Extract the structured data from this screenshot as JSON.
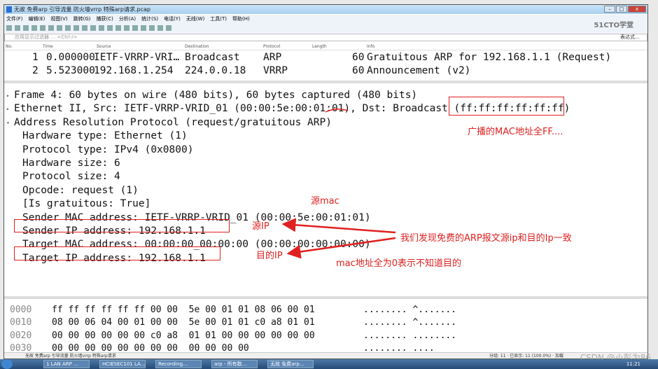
{
  "window": {
    "title": "无故 免费arp 引导流量 防火墙vrrp 特殊arp请求.pcap",
    "logo": "51CTO学堂"
  },
  "menu": [
    "文件(F)",
    "编辑(E)",
    "视图(V)",
    "跳转(G)",
    "捕获(C)",
    "分析(A)",
    "统计(S)",
    "电话(Y)",
    "无线(W)",
    "工具(T)",
    "帮助(H)"
  ],
  "filter": {
    "placeholder": "应用显示过滤器 … <Ctrl-/>",
    "expression_label": "表达式…"
  },
  "packet_list": {
    "columns": [
      "No.",
      "Time",
      "Source",
      "Destination",
      "Protocol",
      "Length",
      "Info"
    ],
    "rows": [
      {
        "no": "1",
        "time": "0.000000",
        "source": "IETF-VRRP-VRI…",
        "destination": "Broadcast",
        "protocol": "ARP",
        "length": "60",
        "info": "Gratuitous ARP for 192.168.1.1 (Request)"
      },
      {
        "no": "2",
        "time": "5.523000",
        "source": "192.168.1.254",
        "destination": "224.0.0.18",
        "protocol": "VRRP",
        "length": "60",
        "info": "Announcement (v2)"
      }
    ]
  },
  "details": [
    "Frame 4: 60 bytes on wire (480 bits), 60 bytes captured (480 bits)",
    "Ethernet II, Src: IETF-VRRP-VRID_01 (00:00:5e:00:01:01), Dst: Broadcast (ff:ff:ff:ff:ff:ff)",
    "Address Resolution Protocol (request/gratuitous ARP)",
    "Hardware type: Ethernet (1)",
    "Protocol type: IPv4 (0x0800)",
    "Hardware size: 6",
    "Protocol size: 4",
    "Opcode: request (1)",
    "[Is gratuitous: True]",
    "Sender MAC address: IETF-VRRP-VRID_01 (00:00:5e:00:01:01)",
    "Sender IP address: 192.168.1.1",
    "Target MAC address: 00:00:00_00:00:00 (00:00:00:00:00:00)",
    "Target IP address: 192.168.1.1"
  ],
  "hex": [
    {
      "offset": "0000",
      "bytes": "ff ff ff ff ff ff 00 00  5e 00 01 01 08 06 00 01",
      "ascii": "........ ^......."
    },
    {
      "offset": "0010",
      "bytes": "08 00 06 04 00 01 00 00  5e 00 01 01 c0 a8 01 01",
      "ascii": "........ ^......."
    },
    {
      "offset": "0020",
      "bytes": "00 00 00 00 00 00 c0 a8  01 01 00 00 00 00 00 00",
      "ascii": "........ ........"
    },
    {
      "offset": "0030",
      "bytes": "00 00 00 00 00 00 00 00  00 00 00 00",
      "ascii": "........ ...."
    }
  ],
  "annotations": {
    "broadcast_note": "广播的MAC地址全FF....",
    "src_mac": "源mac",
    "src_ip": "源IP",
    "same_ip_note": "我们发现免费的ARP报文源ip和目的Ip一致",
    "dst_ip": "目的IP",
    "zero_mac_note": "mac地址全为0表示不知道目的"
  },
  "status": {
    "left": "无故 免费arp 引导流量 防火墙vrrp 特殊arp请求",
    "right": "分组: 11 · 已显示: 11 (100.0%) · 加载"
  },
  "taskbar": {
    "items": [
      "1 LAN ARP …",
      "HCIESEC101 LA…",
      "Recording…",
      "arp - 所有数…",
      "无故 免费arp…"
    ],
    "clock": "11:21"
  },
  "watermark": "CSDN @小彭为86",
  "colors": {
    "annotation": "#e02020"
  }
}
